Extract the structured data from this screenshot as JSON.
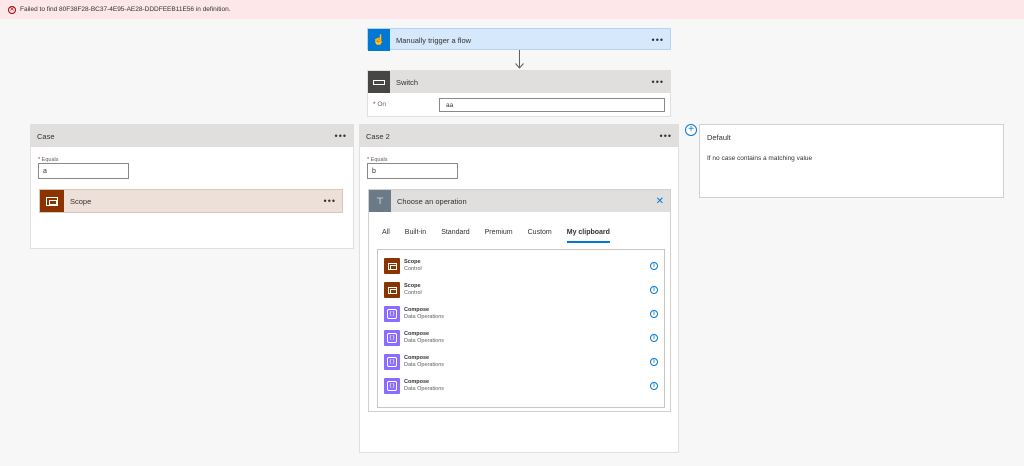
{
  "error": {
    "message": "Failed to find 80F38F28-BC37-4E95-AE28-DDDFEEB11E56 in definition."
  },
  "trigger": {
    "title": "Manually trigger a flow",
    "menu": "•••"
  },
  "switch": {
    "title": "Switch",
    "menu": "•••",
    "on_label": "On",
    "on_value": "aa"
  },
  "case1": {
    "title": "Case",
    "menu": "•••",
    "equals_label": "Equals",
    "equals_value": "a",
    "scope_title": "Scope",
    "scope_menu": "•••"
  },
  "case2": {
    "title": "Case 2",
    "menu": "•••",
    "equals_label": "Equals",
    "equals_value": "b"
  },
  "default": {
    "title": "Default",
    "subtitle": "If no case contains a matching value"
  },
  "add_button": "+",
  "operation": {
    "title": "Choose an operation",
    "close": "✕",
    "tabs": [
      "All",
      "Built-in",
      "Standard",
      "Premium",
      "Custom",
      "My clipboard"
    ],
    "active_tab": "My clipboard",
    "items": [
      {
        "name": "Scope",
        "category": "Control",
        "type": "scope"
      },
      {
        "name": "Scope",
        "category": "Control",
        "type": "scope"
      },
      {
        "name": "Compose",
        "category": "Data Operations",
        "type": "compose"
      },
      {
        "name": "Compose",
        "category": "Data Operations",
        "type": "compose"
      },
      {
        "name": "Compose",
        "category": "Data Operations",
        "type": "compose"
      },
      {
        "name": "Compose",
        "category": "Data Operations",
        "type": "compose"
      }
    ]
  },
  "colors": {
    "accent": "#0078d4",
    "error_bg": "#fde7e9",
    "scope": "#8c3400",
    "compose": "#8c6cff",
    "trigger_bg": "#d6e8fb"
  },
  "icons": {
    "error": "error-circle-icon",
    "trigger": "hand-touch-icon",
    "switch": "switch-icon",
    "scope": "scope-icon",
    "compose": "compose-icon",
    "info": "info-icon",
    "close": "close-icon",
    "add": "add-icon"
  }
}
